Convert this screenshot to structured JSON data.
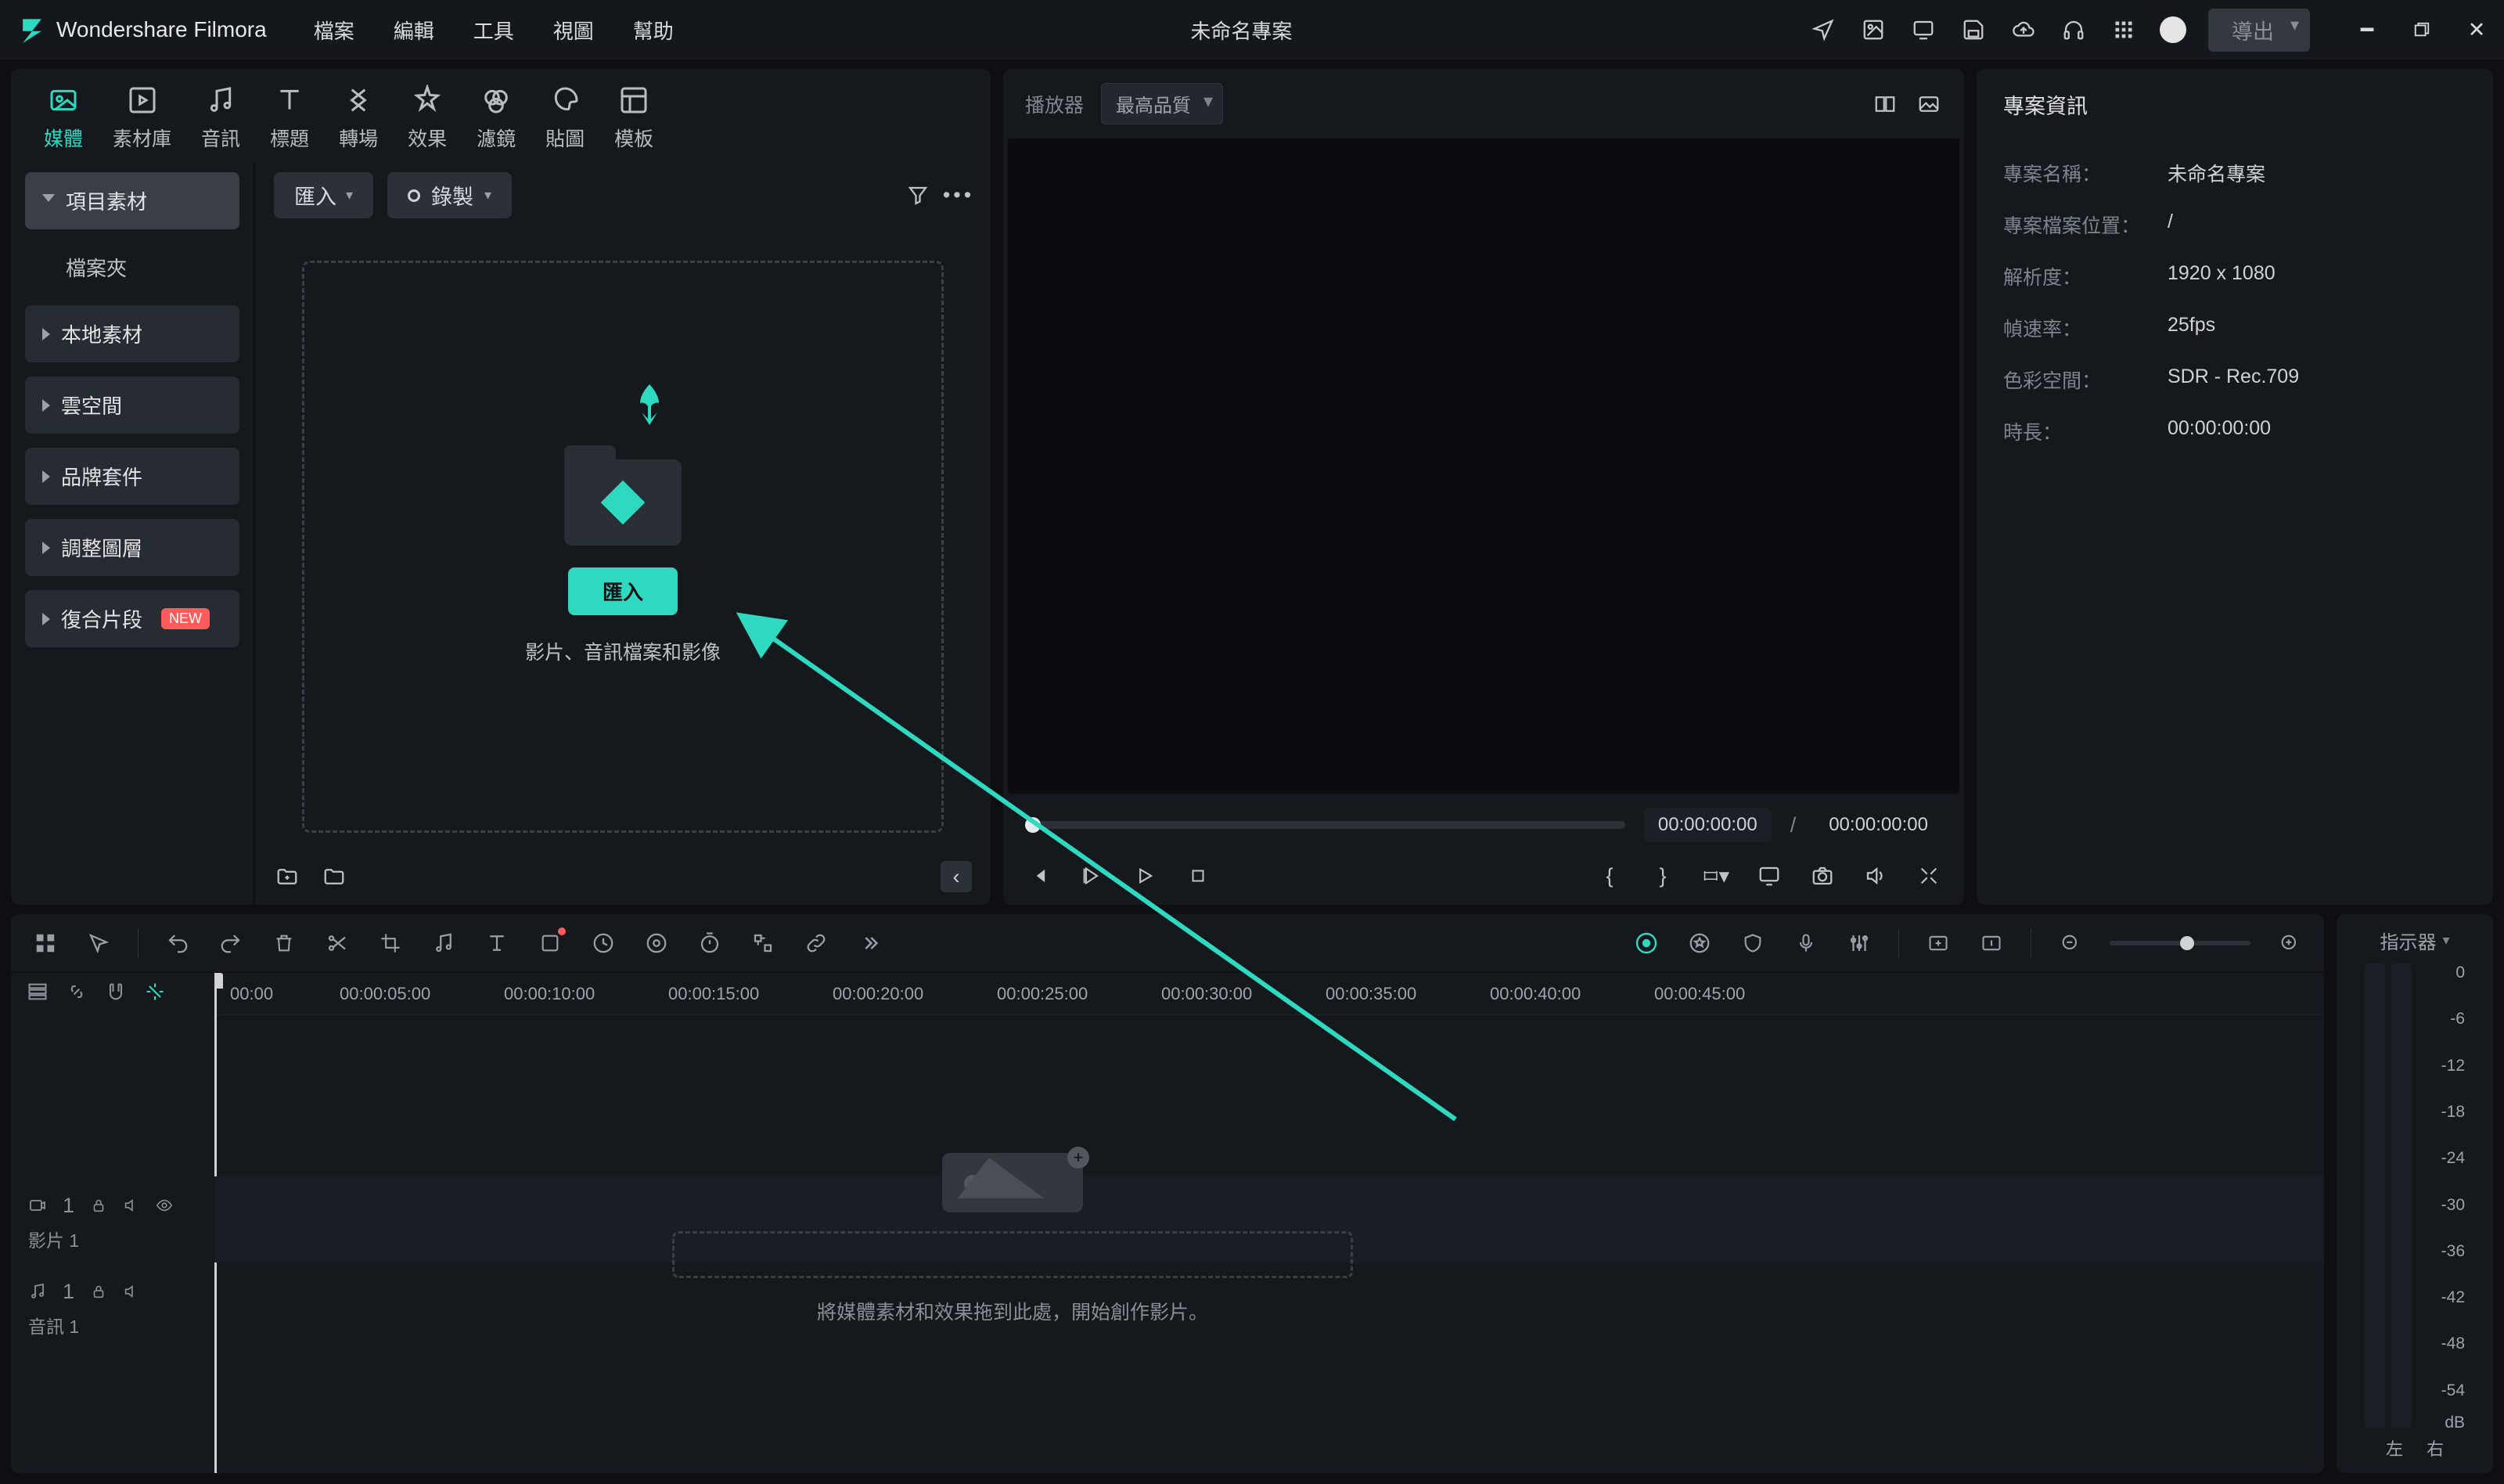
{
  "titlebar": {
    "app_name": "Wondershare Filmora",
    "menus": [
      "檔案",
      "編輯",
      "工具",
      "視圖",
      "幫助"
    ],
    "project_title": "未命名專案",
    "export_label": "導出"
  },
  "media_tabs": [
    {
      "label": "媒體"
    },
    {
      "label": "素材庫"
    },
    {
      "label": "音訊"
    },
    {
      "label": "標題"
    },
    {
      "label": "轉場"
    },
    {
      "label": "效果"
    },
    {
      "label": "濾鏡"
    },
    {
      "label": "貼圖"
    },
    {
      "label": "模板"
    }
  ],
  "sidebar": {
    "project_media": "項目素材",
    "folders": "檔案夾",
    "items": [
      {
        "label": "本地素材"
      },
      {
        "label": "雲空間"
      },
      {
        "label": "品牌套件"
      },
      {
        "label": "調整圖層"
      },
      {
        "label": "復合片段",
        "new": "NEW"
      }
    ]
  },
  "rm_toolbar": {
    "import": "匯入",
    "record": "錄製"
  },
  "dropzone": {
    "btn": "匯入",
    "hint": "影片、音訊檔案和影像"
  },
  "preview": {
    "player_label": "播放器",
    "quality": "最高品質",
    "time_cur": "00:00:00:00",
    "time_tot": "00:00:00:00"
  },
  "info": {
    "title": "專案資訊",
    "rows": [
      {
        "k": "專案名稱：",
        "v": "未命名專案"
      },
      {
        "k": "專案檔案位置：",
        "v": "/"
      },
      {
        "k": "解析度：",
        "v": "1920 x 1080"
      },
      {
        "k": "幀速率：",
        "v": "25fps"
      },
      {
        "k": "色彩空間：",
        "v": "SDR - Rec.709"
      },
      {
        "k": "時長：",
        "v": "00:00:00:00"
      }
    ]
  },
  "timeline": {
    "ruler": [
      "00:00",
      "00:00:05:00",
      "00:00:10:00",
      "00:00:15:00",
      "00:00:20:00",
      "00:00:25:00",
      "00:00:30:00",
      "00:00:35:00",
      "00:00:40:00",
      "00:00:45:00"
    ],
    "drop_hint": "將媒體素材和效果拖到此處，開始創作影片。",
    "track_video": "影片 1",
    "track_audio": "音訊 1"
  },
  "meter": {
    "title": "指示器",
    "scale": [
      "0",
      "-6",
      "-12",
      "-18",
      "-24",
      "-30",
      "-36",
      "-42",
      "-48",
      "-54"
    ],
    "unit": "dB",
    "left": "左",
    "right": "右"
  }
}
